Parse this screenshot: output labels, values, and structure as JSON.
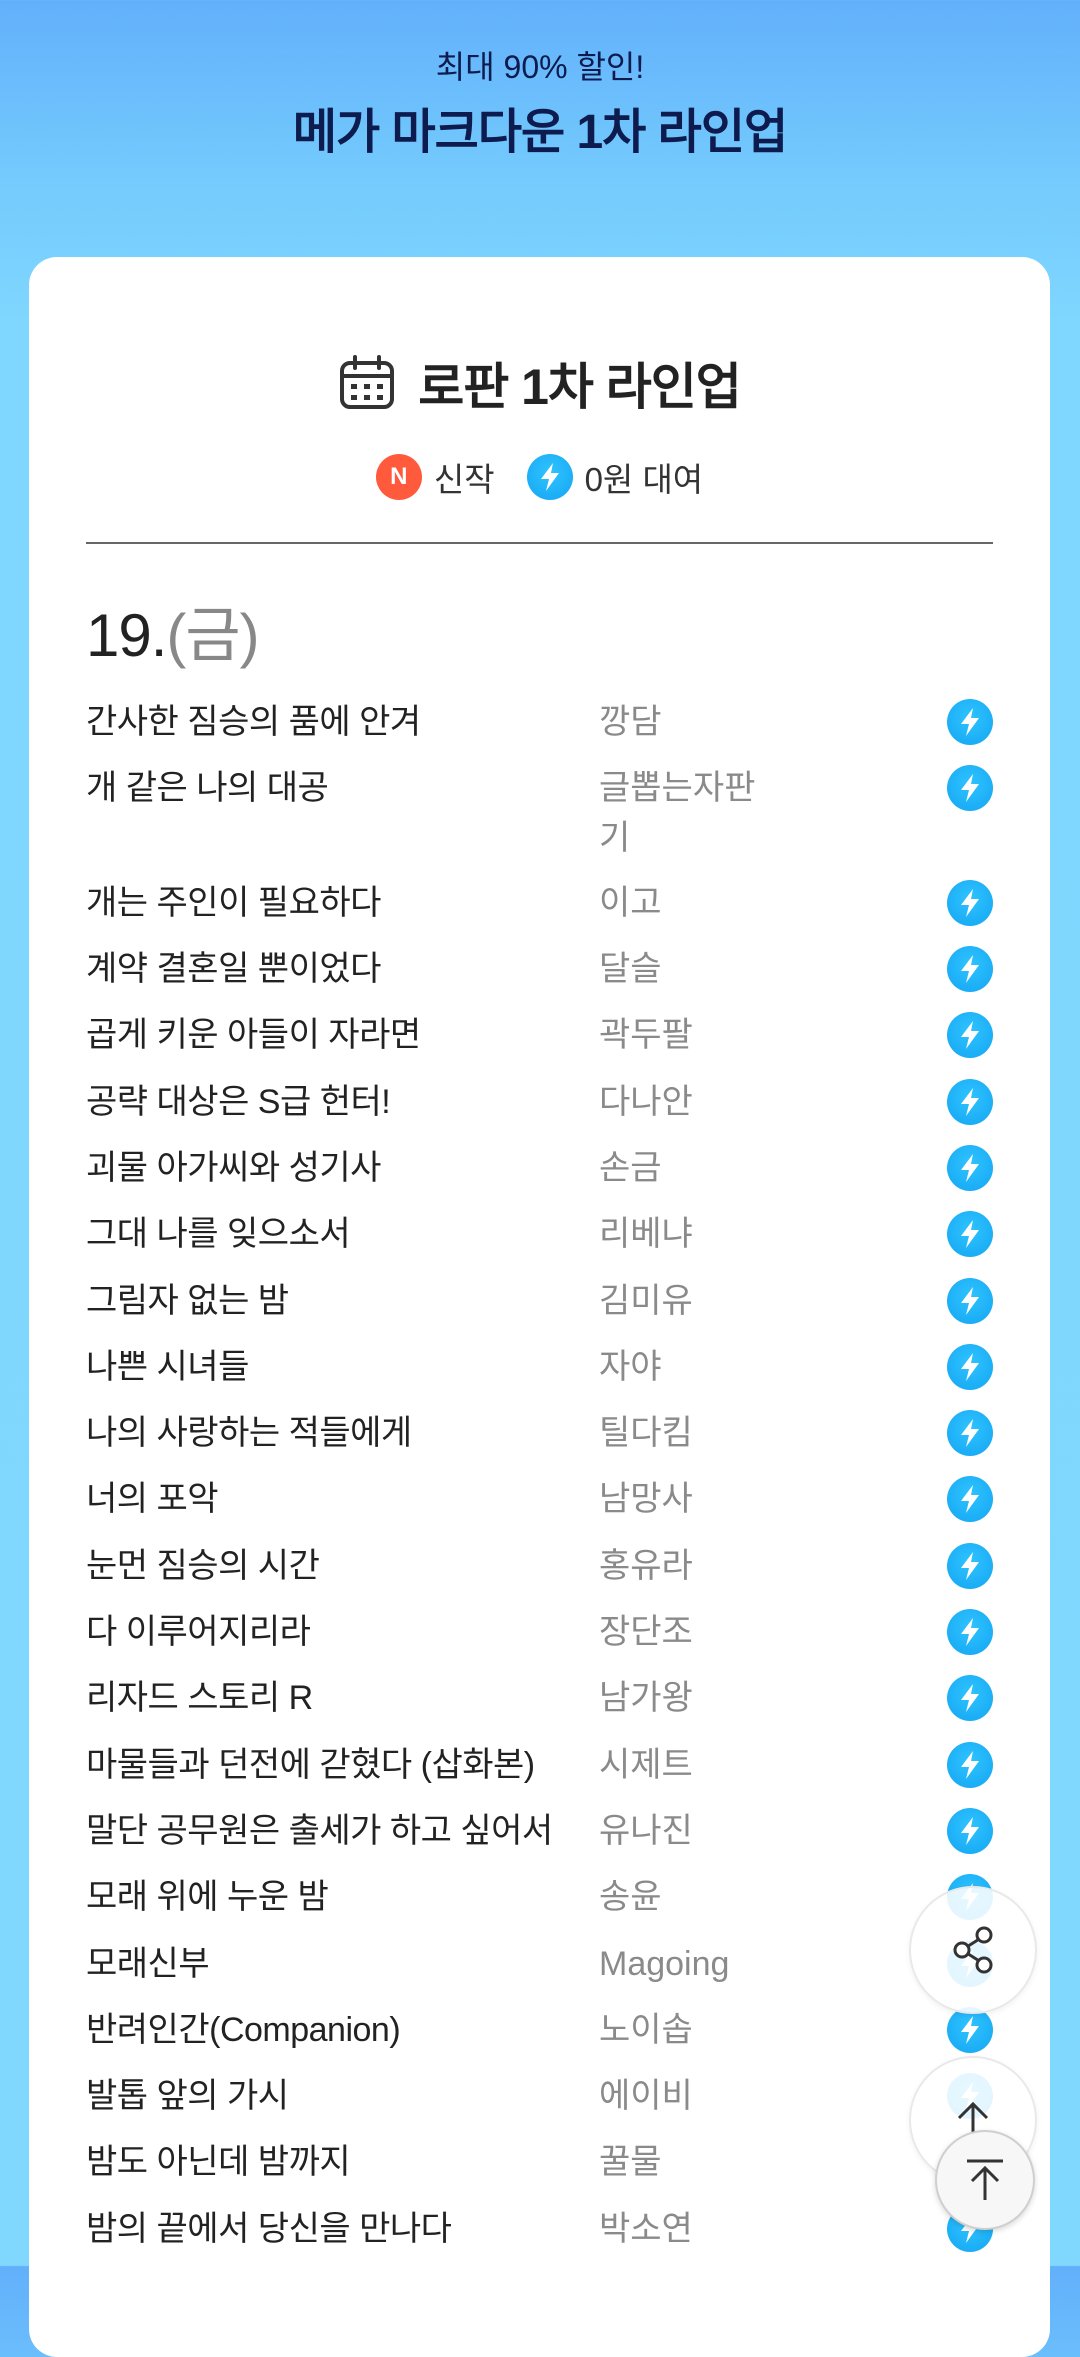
{
  "header": {
    "subtitle": "최대 90% 할인!",
    "title": "메가 마크다운 1차 라인업"
  },
  "card": {
    "title": "로판 1차 라인업",
    "calendar_icon": "calendar-icon",
    "legend": {
      "new_badge": "N",
      "new_label": "신작",
      "free_label": "0원 대여"
    },
    "date": "19.",
    "day": "(금)"
  },
  "colors": {
    "new_badge": "#ff5a3c",
    "bolt_badge": "#1eb3f7",
    "title_text": "#0d1b4e"
  },
  "books": [
    {
      "title": "간사한 짐승의 품에 안겨",
      "author": "깡담"
    },
    {
      "title": "개 같은 나의 대공",
      "author": "글뽑는자판기"
    },
    {
      "title": "개는 주인이 필요하다",
      "author": "이고"
    },
    {
      "title": "계약 결혼일 뿐이었다",
      "author": "달슬"
    },
    {
      "title": "곱게 키운 아들이 자라면",
      "author": "곽두팔"
    },
    {
      "title": "공략 대상은 S급 헌터!",
      "author": "다나안"
    },
    {
      "title": "괴물 아가씨와 성기사",
      "author": "손금"
    },
    {
      "title": "그대 나를 잊으소서",
      "author": "리베냐"
    },
    {
      "title": "그림자 없는 밤",
      "author": "김미유"
    },
    {
      "title": "나쁜 시녀들",
      "author": "자야"
    },
    {
      "title": "나의 사랑하는 적들에게",
      "author": "틸다킴"
    },
    {
      "title": "너의 포악",
      "author": "남망사"
    },
    {
      "title": "눈먼 짐승의 시간",
      "author": "홍유라"
    },
    {
      "title": "다 이루어지리라",
      "author": "장단조"
    },
    {
      "title": "리자드 스토리 R",
      "author": "남가왕"
    },
    {
      "title": "마물들과 던전에 갇혔다 (삽화본)",
      "author": "시제트"
    },
    {
      "title": "말단 공무원은 출세가 하고 싶어서",
      "author": "유나진"
    },
    {
      "title": "모래 위에 누운 밤",
      "author": "송윤"
    },
    {
      "title": "모래신부",
      "author": "Magoing"
    },
    {
      "title": "반려인간(Companion)",
      "author": "노이솝"
    },
    {
      "title": "발톱 앞의 가시",
      "author": "에이비"
    },
    {
      "title": "밤도 아닌데 밤까지",
      "author": "꿀물"
    },
    {
      "title": "밤의 끝에서 당신을 만나다",
      "author": "박소연"
    }
  ]
}
